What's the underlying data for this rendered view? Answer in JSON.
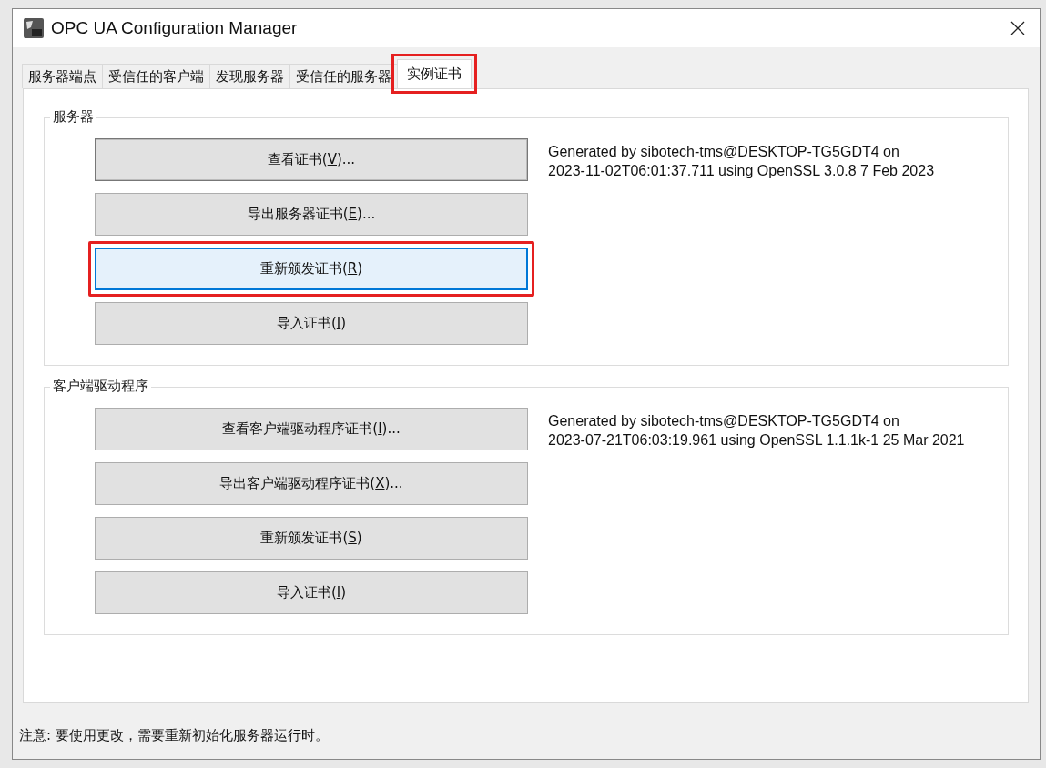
{
  "window": {
    "title": "OPC UA Configuration Manager"
  },
  "tabs": [
    {
      "label": "服务器端点",
      "selected": false,
      "highlighted": false
    },
    {
      "label": "受信任的客户端",
      "selected": false,
      "highlighted": false
    },
    {
      "label": "发现服务器",
      "selected": false,
      "highlighted": false
    },
    {
      "label": "受信任的服务器",
      "selected": false,
      "highlighted": false
    },
    {
      "label": "实例证书",
      "selected": true,
      "highlighted": true
    }
  ],
  "groups": [
    {
      "title": "服务器",
      "info": [
        "Generated by sibotech-tms@DESKTOP-TG5GDT4 on",
        "2023-11-02T06:01:37.711 using OpenSSL 3.0.8 7 Feb 2023"
      ],
      "buttons": [
        {
          "before": "查看证书(",
          "key": "V",
          "after": ")...",
          "default": true,
          "focused": false,
          "highlighted": false
        },
        {
          "before": "导出服务器证书(",
          "key": "E",
          "after": ")...",
          "default": false,
          "focused": false,
          "highlighted": false
        },
        {
          "before": "重新颁发证书(",
          "key": "R",
          "after": ")",
          "default": false,
          "focused": true,
          "highlighted": true
        },
        {
          "before": "导入证书(",
          "key": "I",
          "after": ")",
          "default": false,
          "focused": false,
          "highlighted": false
        }
      ]
    },
    {
      "title": "客户端驱动程序",
      "info": [
        "Generated by sibotech-tms@DESKTOP-TG5GDT4 on",
        "2023-07-21T06:03:19.961 using OpenSSL 1.1.1k-1  25 Mar 2021"
      ],
      "buttons": [
        {
          "before": "查看客户端驱动程序证书(",
          "key": "I",
          "after": ")...",
          "default": false,
          "focused": false,
          "highlighted": false
        },
        {
          "before": "导出客户端驱动程序证书(",
          "key": "X",
          "after": ")...",
          "default": false,
          "focused": false,
          "highlighted": false
        },
        {
          "before": "重新颁发证书(",
          "key": "S",
          "after": ")",
          "default": false,
          "focused": false,
          "highlighted": false
        },
        {
          "before": "导入证书(",
          "key": "I",
          "after": ")",
          "default": false,
          "focused": false,
          "highlighted": false
        }
      ]
    }
  ],
  "status_note": "注意: 要使用更改，需要重新初始化服务器运行时。"
}
